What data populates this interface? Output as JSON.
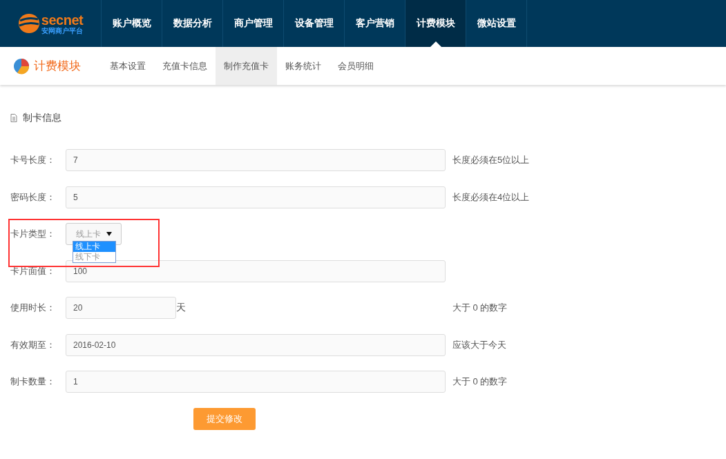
{
  "brand": {
    "name": "secnet",
    "subtitle": "安网商户平台"
  },
  "nav": [
    {
      "label": "账户概览",
      "selected": false
    },
    {
      "label": "数据分析",
      "selected": false
    },
    {
      "label": "商户管理",
      "selected": false
    },
    {
      "label": "设备管理",
      "selected": false
    },
    {
      "label": "客户营销",
      "selected": false
    },
    {
      "label": "计费模块",
      "selected": true
    },
    {
      "label": "微站设置",
      "selected": false
    }
  ],
  "module": {
    "title": "计费模块"
  },
  "subnav": [
    {
      "label": "基本设置",
      "selected": false
    },
    {
      "label": "充值卡信息",
      "selected": false
    },
    {
      "label": "制作充值卡",
      "selected": true
    },
    {
      "label": "账务统计",
      "selected": false
    },
    {
      "label": "会员明细",
      "selected": false
    }
  ],
  "section_title": "制卡信息",
  "fields": [
    {
      "kind": "text",
      "label": "卡号长度：",
      "value": "7",
      "hint": "长度必须在5位以上"
    },
    {
      "kind": "text",
      "label": "密码长度：",
      "value": "5",
      "hint": "长度必须在4位以上"
    },
    {
      "kind": "select",
      "label": "卡片类型：",
      "value": "线上卡",
      "options": [
        {
          "label": "线上卡",
          "selected": true
        },
        {
          "label": "线下卡",
          "selected": false
        }
      ]
    },
    {
      "kind": "text",
      "label": "卡片面值：",
      "value": "100"
    },
    {
      "kind": "short",
      "label": "使用时长：",
      "value": "20",
      "unit": "天",
      "hint": "大于 0 的数字"
    },
    {
      "kind": "text",
      "label": "有效期至：",
      "value": "2016-02-10",
      "hint": "应该大于今天"
    },
    {
      "kind": "text",
      "label": "制卡数量：",
      "value": "1",
      "hint": "大于 0 的数字"
    }
  ],
  "submit": "提交修改"
}
